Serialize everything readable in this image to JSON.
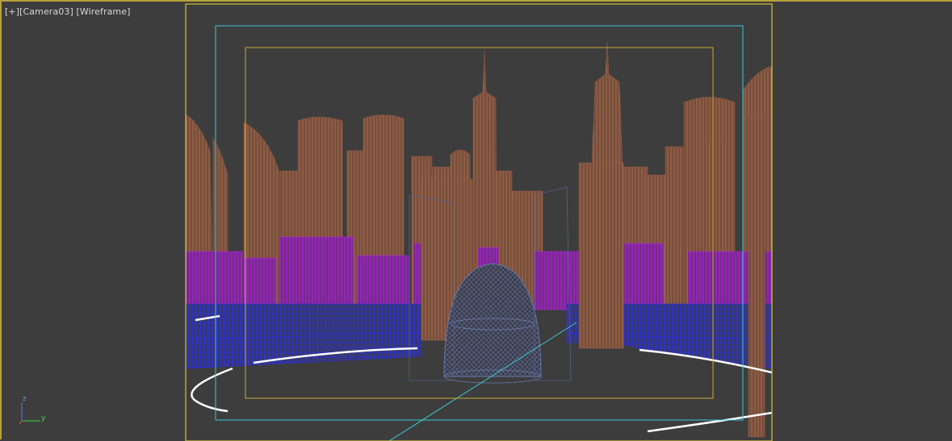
{
  "viewport": {
    "menu_plus": "[+]",
    "camera": "[Camera03]",
    "shading": "[Wireframe]"
  },
  "axis_gizmo": {
    "z_label": "z",
    "y_label": "y"
  },
  "colors": {
    "background": "#3d3d3d",
    "active_border": "#b8a23a",
    "render_frame": "#d4c23a",
    "title_safe": "#ccaa33",
    "action_safe": "#3cc8d8",
    "buildings_far": "#a0674a",
    "buildings_mid": "#b020d8",
    "buildings_near": "#1e22e0",
    "dome": "#5a6c98",
    "roads": "#ffffff"
  }
}
